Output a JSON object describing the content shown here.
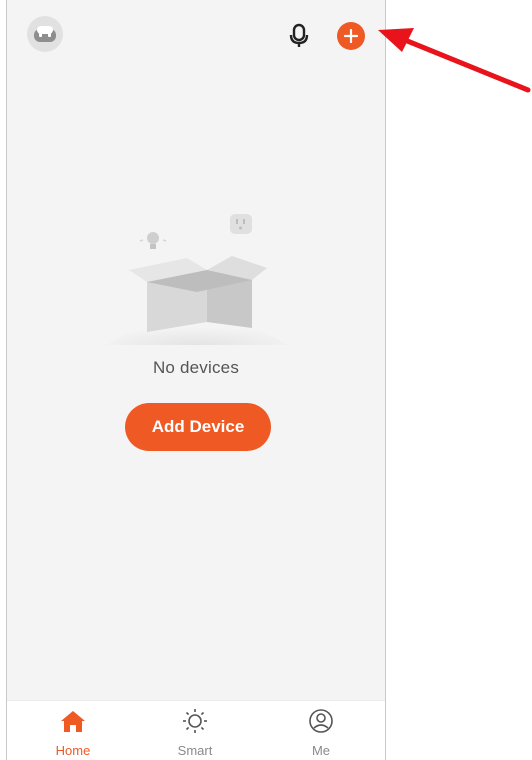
{
  "header": {
    "avatar_icon": "robot-avatar-icon",
    "mic_icon": "microphone-icon",
    "add_icon": "plus-icon"
  },
  "empty_state": {
    "illustration": "empty-box-illustration",
    "message": "No devices",
    "button_label": "Add Device"
  },
  "tabbar": {
    "tabs": [
      {
        "label": "Home",
        "icon": "home-icon",
        "active": true
      },
      {
        "label": "Smart",
        "icon": "sun-icon",
        "active": false
      },
      {
        "label": "Me",
        "icon": "profile-icon",
        "active": false
      }
    ]
  },
  "annotation": {
    "arrow_color": "#e8131b",
    "points_to": "add-device-plus-button"
  },
  "colors": {
    "accent": "#ef5a24",
    "background": "#f4f4f4",
    "tab_inactive": "#8a8a8a"
  }
}
